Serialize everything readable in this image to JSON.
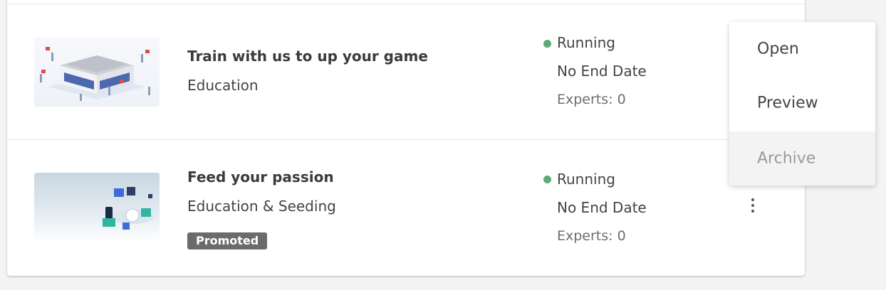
{
  "campaigns": [
    {
      "title": "Train with us to up your game",
      "category": "Education",
      "badge": "",
      "status": "Running",
      "end_date": "No End Date",
      "experts": "Experts: 0"
    },
    {
      "title": "Feed your passion",
      "category": "Education & Seeding",
      "badge": "Promoted",
      "status": "Running",
      "end_date": "No End Date",
      "experts": "Experts: 0"
    }
  ],
  "menu": {
    "items": [
      {
        "label": "Open",
        "enabled": true
      },
      {
        "label": "Preview",
        "enabled": true
      },
      {
        "label": "Archive",
        "enabled": false
      }
    ]
  },
  "colors": {
    "status_running": "#5bab74",
    "badge_bg": "#6b6b6b"
  },
  "icons": {
    "row_menu": "more-vertical-icon"
  }
}
